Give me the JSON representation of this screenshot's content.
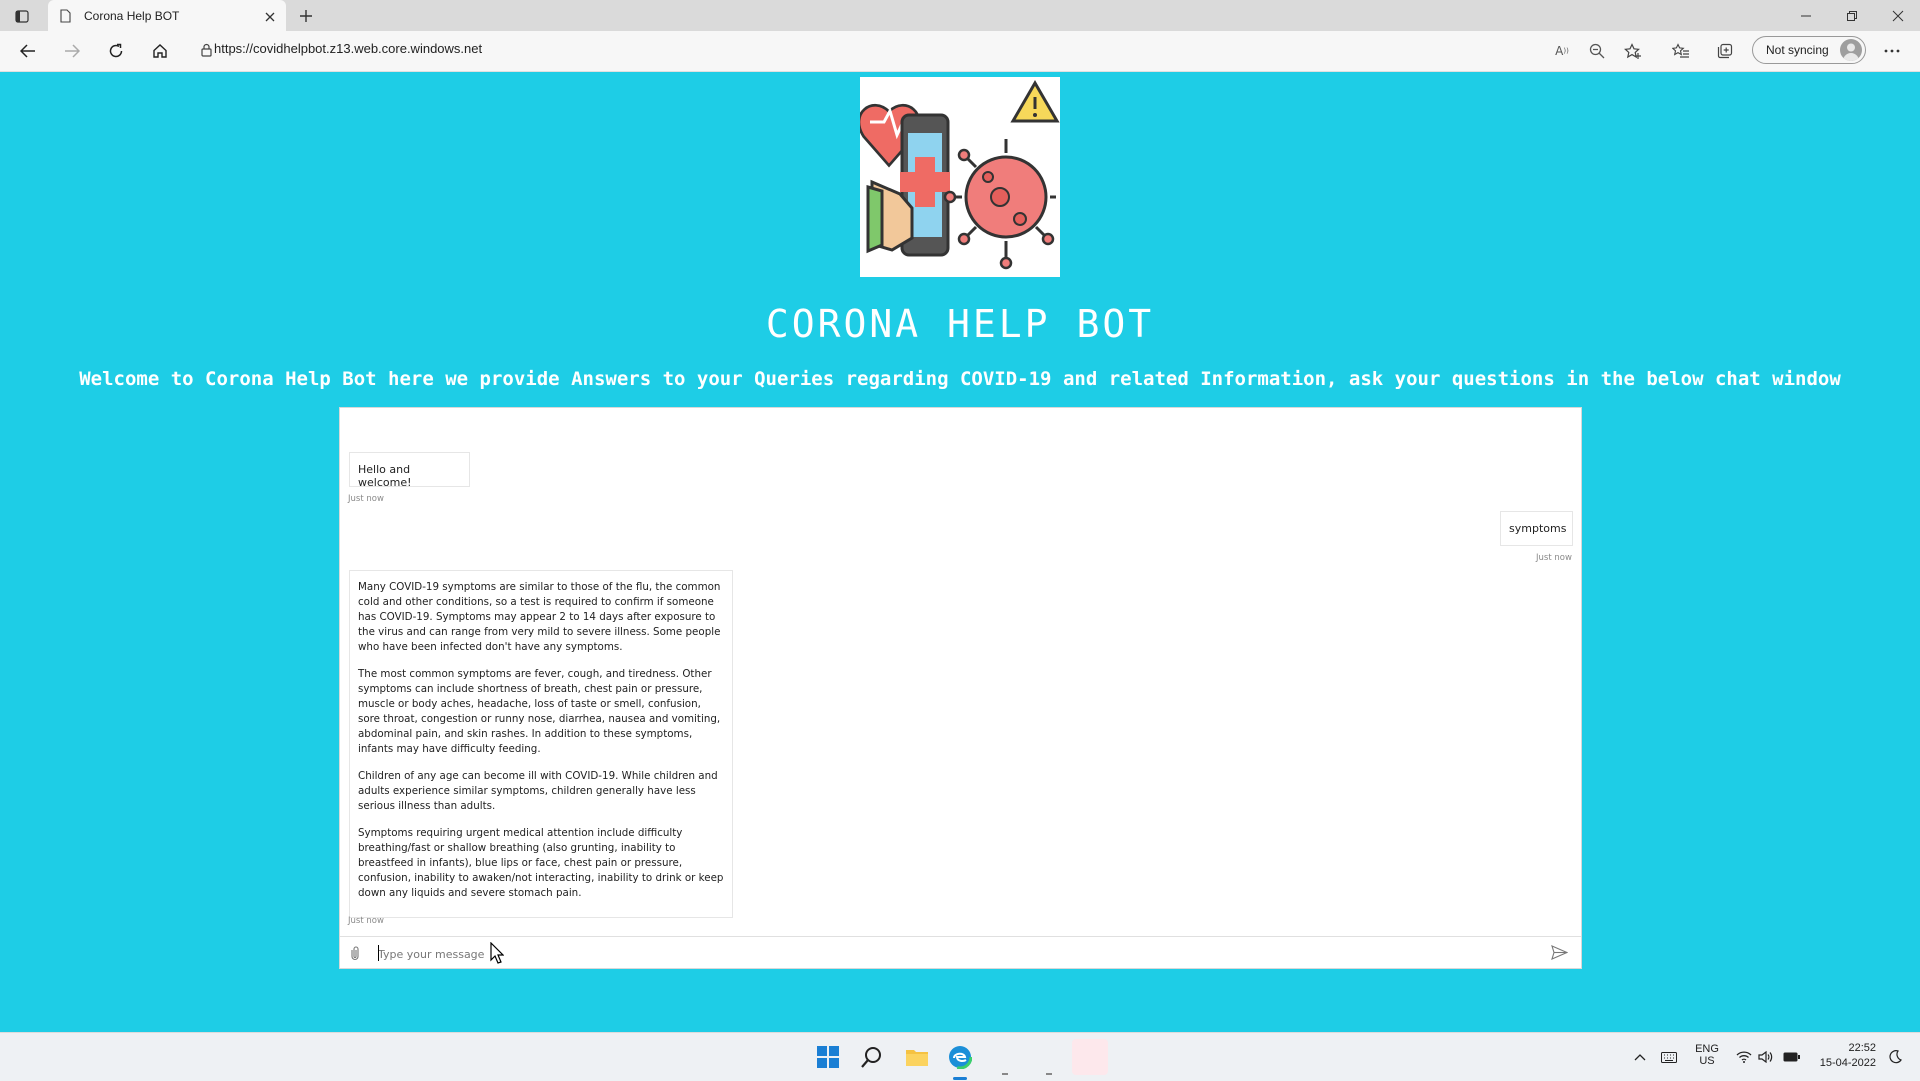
{
  "browser": {
    "tab_title": "Corona Help BOT",
    "url": "https://covidhelpbot.z13.web.core.windows.net",
    "sync_label": "Not syncing",
    "icons": [
      "sidebar-icon",
      "page-icon",
      "close-icon",
      "new-tab-icon",
      "back-icon",
      "forward-icon",
      "refresh-icon",
      "home-icon",
      "lock-icon",
      "read-aloud-icon",
      "zoom-out-icon",
      "add-favorite-icon",
      "favorites-icon",
      "collections-icon",
      "profile-avatar-icon",
      "more-icon",
      "minimize-icon",
      "restore-icon",
      "window-close-icon"
    ]
  },
  "page": {
    "title": "CORONA HELP BOT",
    "subtitle": "Welcome to Corona Help Bot here we provide Answers to your Queries regarding COVID-19 and related Information, ask your questions in the below chat window",
    "background_color": "#1ecde6"
  },
  "chat": {
    "messages": [
      {
        "from": "bot",
        "text": "Hello and welcome!",
        "time": "Just now"
      },
      {
        "from": "user",
        "text": "symptoms",
        "time": "Just now"
      },
      {
        "from": "bot",
        "time": "Just now",
        "paragraphs": [
          "Many COVID-19 symptoms are similar to those of the flu, the common cold and other conditions, so a test is required to confirm if someone has COVID-19. Symptoms may appear 2 to 14 days after exposure to the virus and can range from very mild to severe illness. Some people who have been infected don't have any symptoms.",
          "The most common symptoms are fever, cough, and tiredness. Other symptoms can include shortness of breath, chest pain or pressure, muscle or body aches, headache, loss of taste or smell, confusion, sore throat, congestion or runny nose, diarrhea, nausea and vomiting, abdominal pain, and skin rashes. In addition to these symptoms, infants may have difficulty feeding.",
          "Children of any age can become ill with COVID-19. While children and adults experience similar symptoms, children generally have less serious illness than adults.",
          "Symptoms requiring urgent medical attention include difficulty breathing/fast or shallow breathing (also grunting, inability to breastfeed in infants), blue lips or face, chest pain or pressure, confusion, inability to awaken/not interacting, inability to drink or keep down any liquids and severe stomach pain."
        ]
      }
    ],
    "input_placeholder": "Type your message",
    "input_value": ""
  },
  "taskbar": {
    "apps": [
      "start-icon",
      "search-icon",
      "file-explorer-icon",
      "edge-icon"
    ],
    "language": "ENG",
    "region": "US",
    "time": "22:52",
    "date": "15-04-2022"
  }
}
